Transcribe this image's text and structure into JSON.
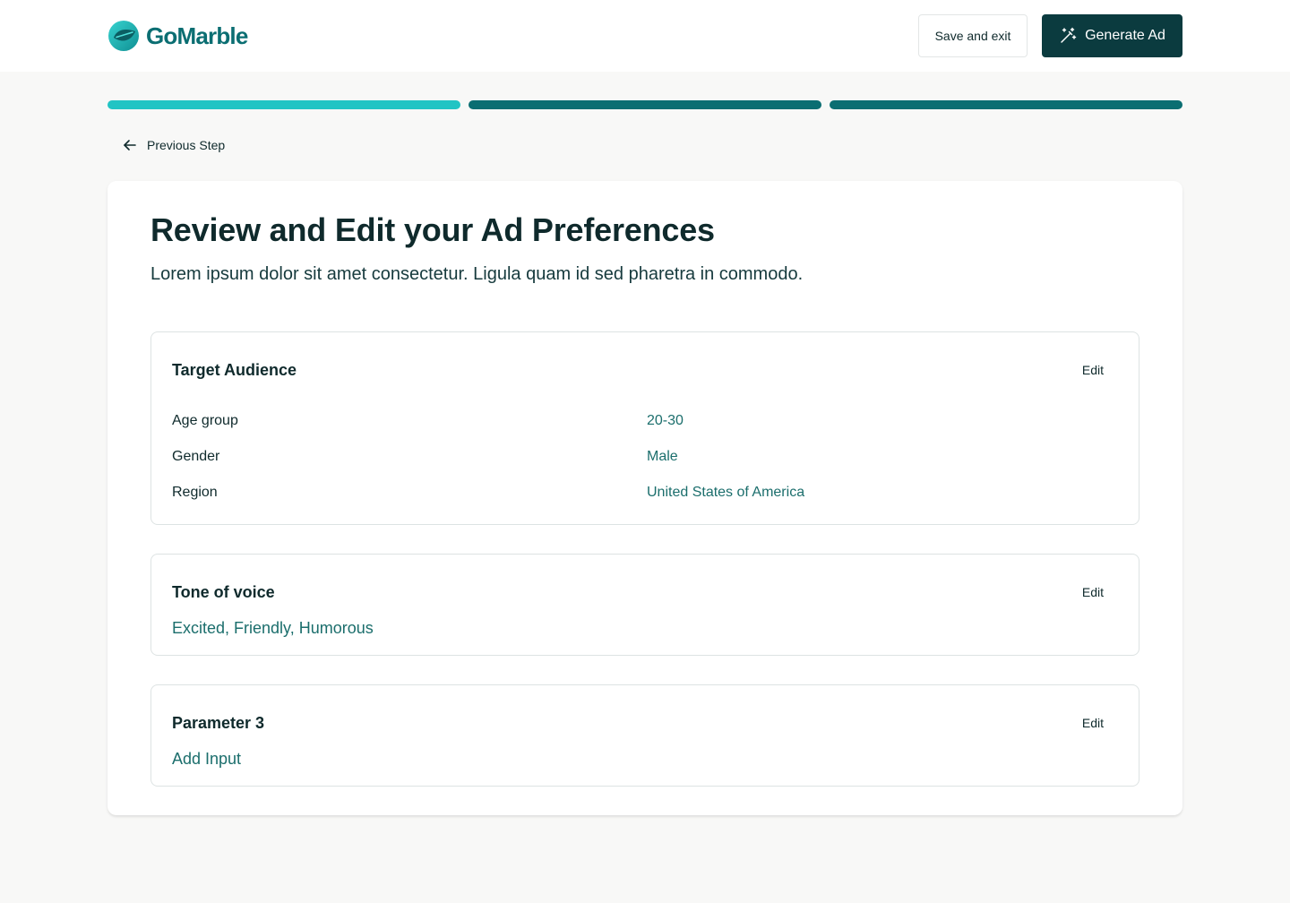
{
  "app": {
    "logo_text": "GoMarble"
  },
  "header": {
    "save_label": "Save and exit",
    "generate_label": "Generate Ad"
  },
  "progress": {
    "steps": [
      {
        "state": "complete",
        "color": "#21c4c4"
      },
      {
        "state": "current",
        "color": "#0b6e72"
      },
      {
        "state": "upcoming",
        "color": "#0b6e72"
      }
    ]
  },
  "nav": {
    "previous_label": "Previous Step"
  },
  "main": {
    "title": "Review and Edit your Ad Preferences",
    "subtitle": "Lorem ipsum dolor sit amet consectetur. Ligula quam id sed pharetra in commodo.",
    "sections": [
      {
        "title": "Target Audience",
        "edit_label": "Edit",
        "rows": [
          {
            "label": "Age group",
            "value": "20-30"
          },
          {
            "label": "Gender",
            "value": "Male"
          },
          {
            "label": "Region",
            "value": "United States of America"
          }
        ]
      },
      {
        "title": "Tone of voice",
        "edit_label": "Edit",
        "value": "Excited, Friendly, Humorous"
      },
      {
        "title": "Parameter 3",
        "edit_label": "Edit",
        "value": "Add Input"
      }
    ]
  },
  "colors": {
    "brand": "#0b6e72",
    "brand_dark": "#0b3b3f",
    "accent": "#21c4c4",
    "value_text": "#1b6e6c"
  },
  "icons": {
    "logo": "leaf-logo-icon",
    "generate": "magic-wand-icon",
    "back": "arrow-left-icon"
  }
}
